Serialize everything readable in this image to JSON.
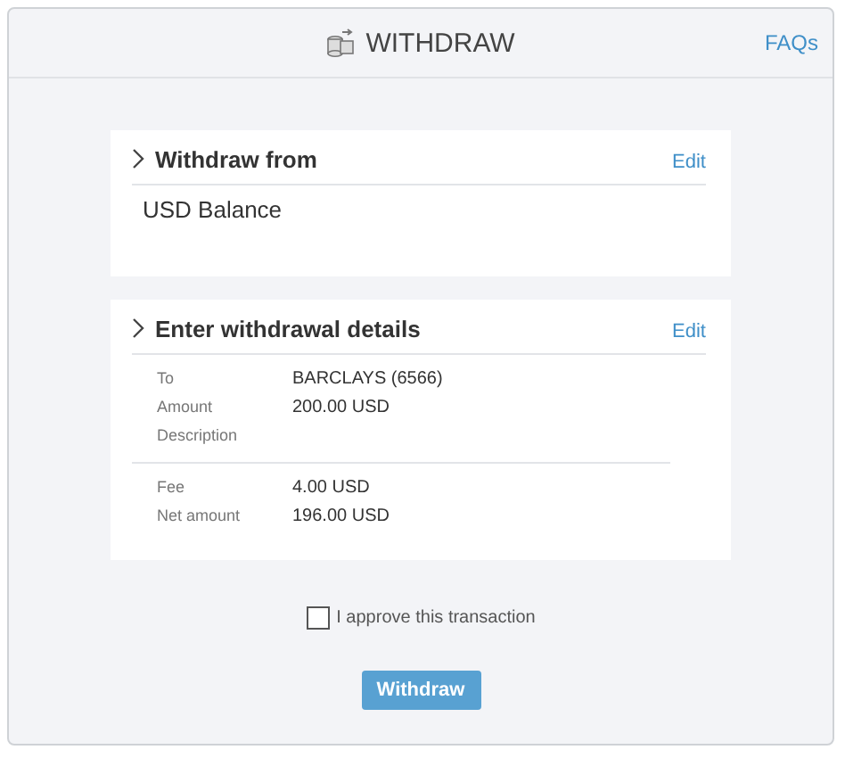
{
  "header": {
    "title": "WITHDRAW",
    "link": "FAQs"
  },
  "sections": [
    {
      "title": "Withdraw from",
      "action": "Edit",
      "value": "USD Balance"
    },
    {
      "title": "Enter withdrawal details",
      "action": "Edit",
      "groups": [
        [
          {
            "label": "To",
            "value": "BARCLAYS (6566)"
          },
          {
            "label": "Amount",
            "value": "200.00 USD"
          },
          {
            "label": "Description"
          }
        ],
        [
          {
            "label": "Fee",
            "value": "4.00 USD"
          },
          {
            "label": "Net amount",
            "value": "196.00 USD"
          }
        ]
      ]
    }
  ],
  "approve": {
    "label": "I approve this transaction",
    "checked": false
  },
  "submit": "Withdraw"
}
